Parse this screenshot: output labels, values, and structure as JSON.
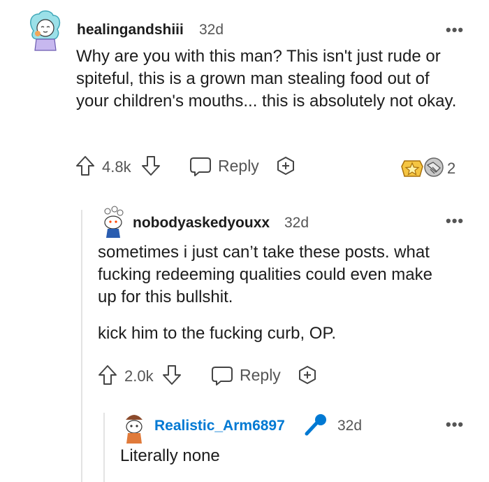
{
  "comments": [
    {
      "username": "healingandshiii",
      "time": "32d",
      "body": "Why are you with this man? This isn't just rude or spiteful, this is a grown man stealing food out of your children's mouths... this is absolutely not okay.",
      "votes": "4.8k",
      "reply_label": "Reply",
      "award_count": "2",
      "more": "•••"
    },
    {
      "username": "nobodyaskedyouxx",
      "time": "32d",
      "paragraphs": [
        "sometimes i just can’t take these posts. what fucking redeeming qualities could even make up for this bullshit.",
        "kick him to the fucking curb, OP."
      ],
      "votes": "2.0k",
      "reply_label": "Reply",
      "more": "•••"
    },
    {
      "username": "Realistic_Arm6897",
      "time": "32d",
      "body": "Literally none",
      "more": "•••",
      "username_color": "#0079d3"
    }
  ],
  "colors": {
    "award_gold": "#f5c542",
    "mic_blue": "#0079d3"
  }
}
